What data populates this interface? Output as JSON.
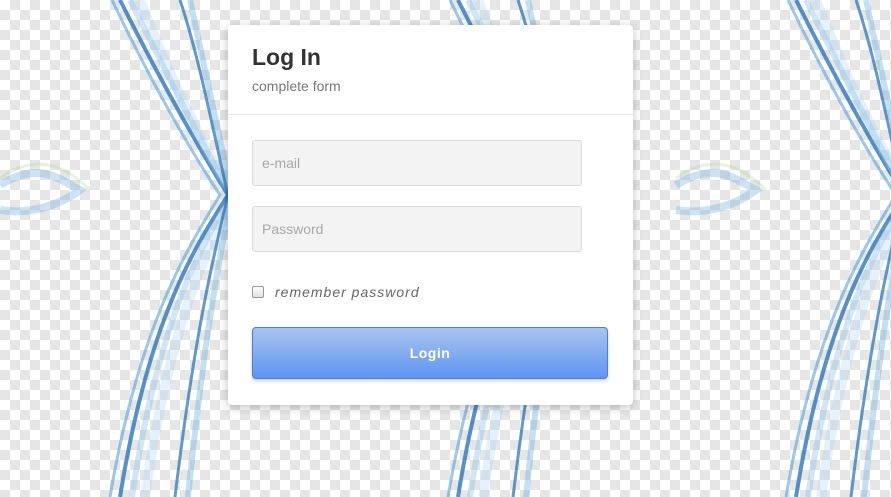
{
  "colors": {
    "accent": "#5f95f2",
    "wave": "#1f6fb5"
  },
  "form": {
    "title": "Log In",
    "subtitle": "complete form",
    "email_placeholder": "e-mail",
    "password_placeholder": "Password",
    "remember_label": "remember password",
    "remember_checked": false,
    "login_label": "Login"
  }
}
